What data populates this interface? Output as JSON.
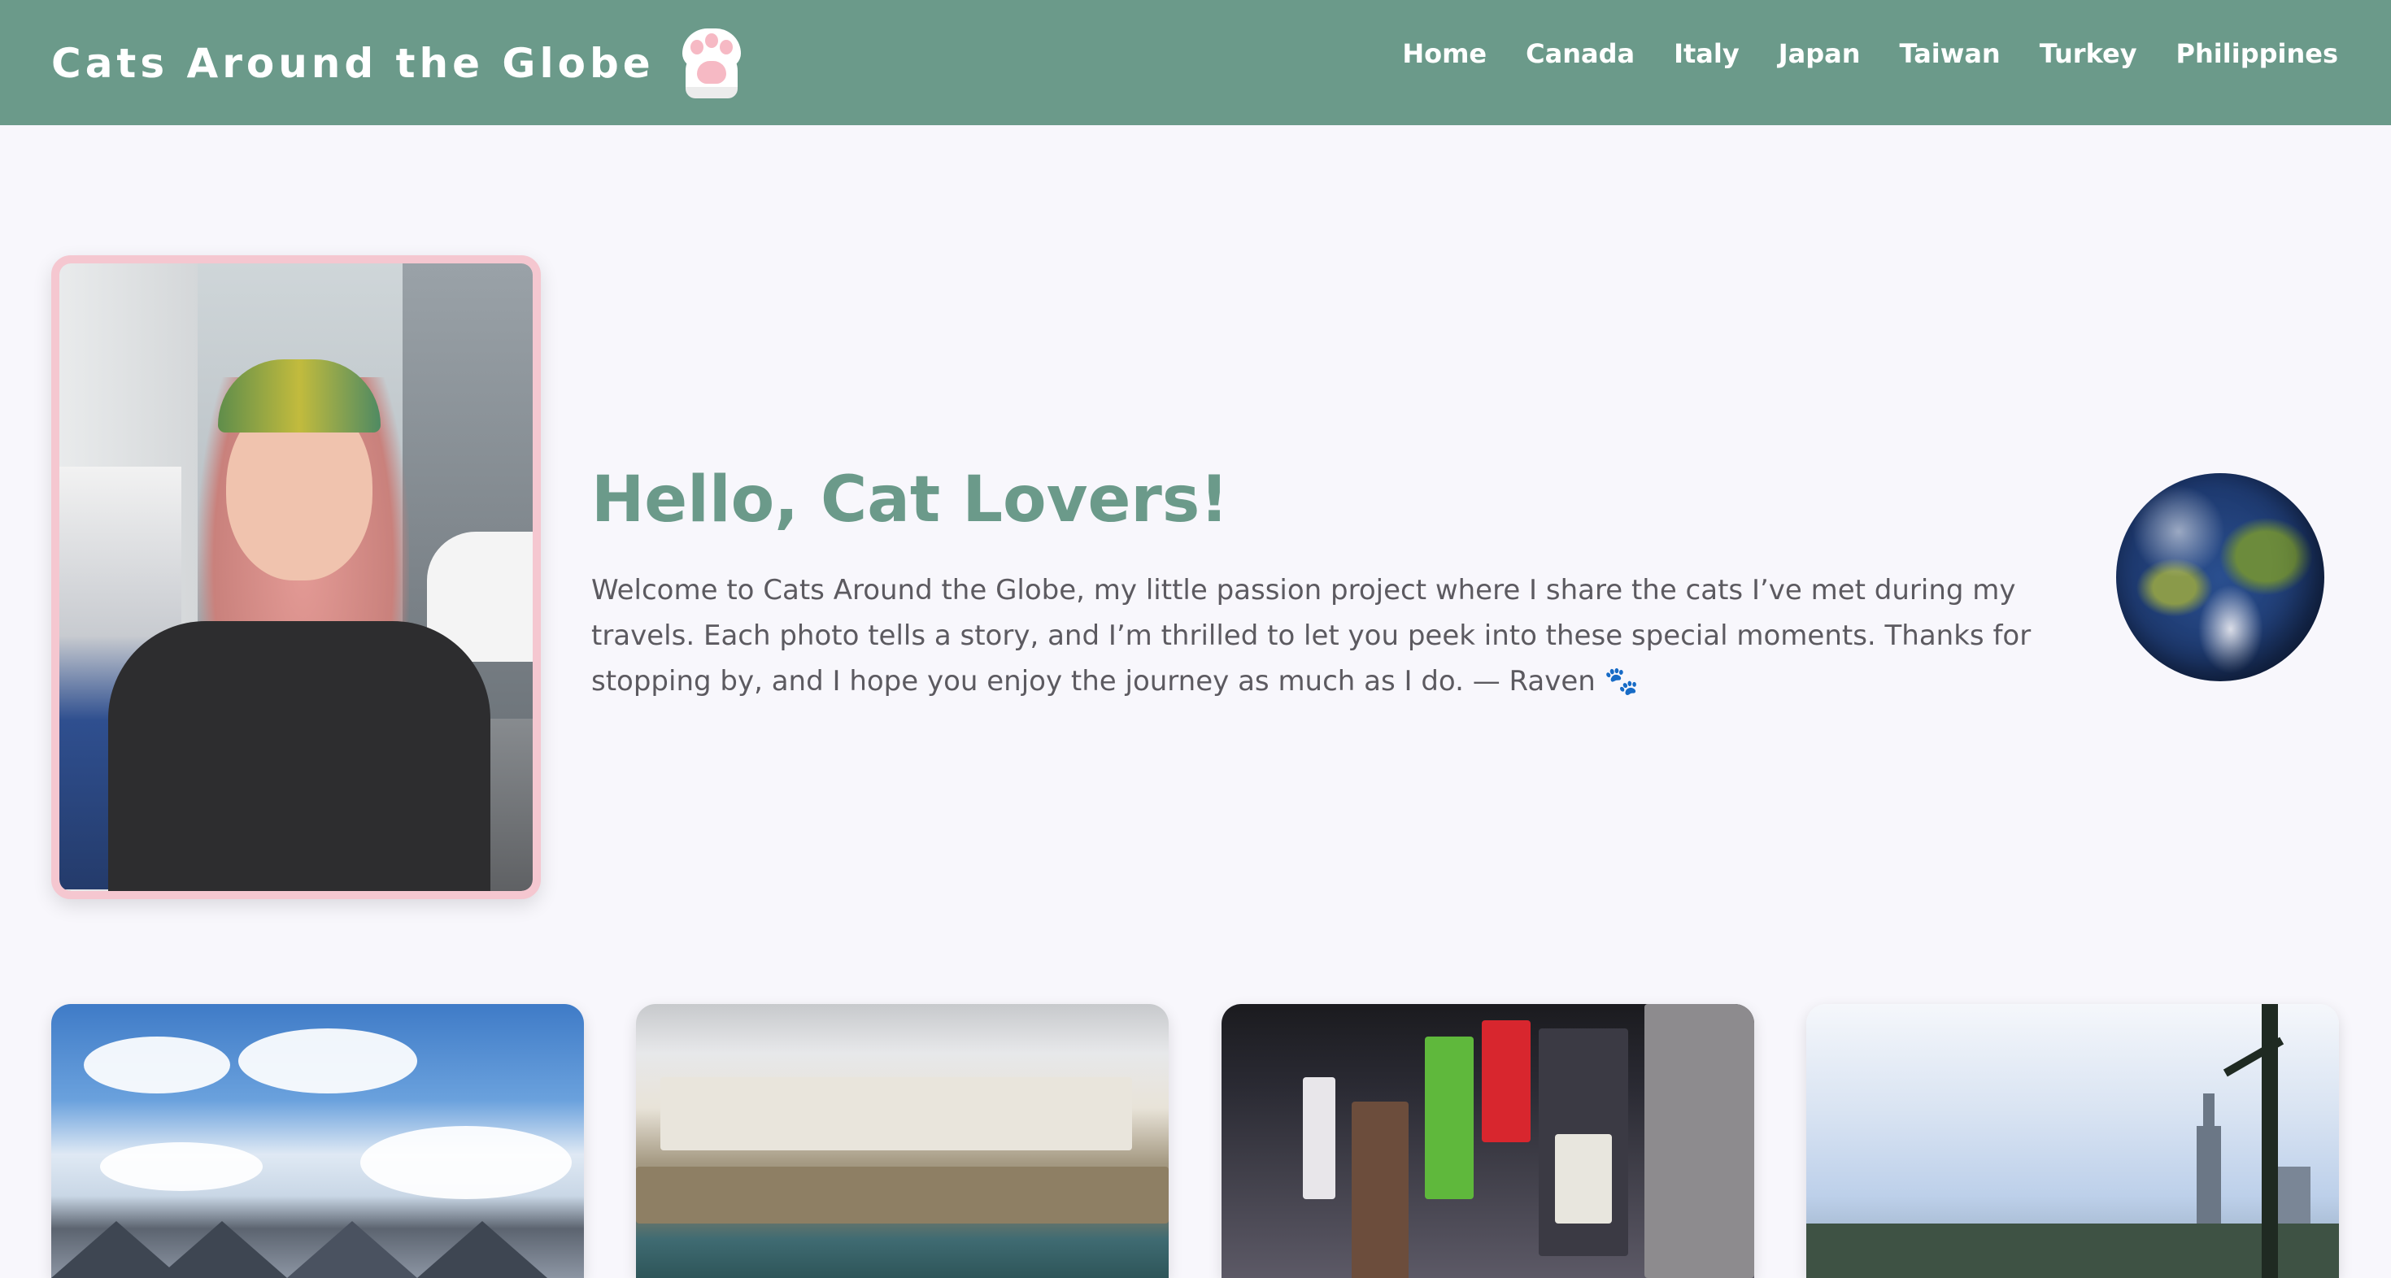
{
  "header": {
    "site_title": "Cats Around the Globe",
    "logo_icon": "paw-sock-icon",
    "nav": [
      {
        "label": "Home"
      },
      {
        "label": "Canada"
      },
      {
        "label": "Italy"
      },
      {
        "label": "Japan"
      },
      {
        "label": "Taiwan"
      },
      {
        "label": "Turkey"
      },
      {
        "label": "Philippines"
      }
    ]
  },
  "hero": {
    "title": "Hello, Cat Lovers!",
    "text": "Welcome to Cats Around the Globe, my little passion project where I share the cats I’ve met during my travels. Each photo tells a story, and I’m thrilled to let you peek into these special moments. Thanks for stopping by, and I hope you enjoy the journey as much as I do. — Raven 🐾",
    "globe_icon": "earth-globe-icon"
  },
  "cards": [
    {
      "image": "canada-mountains-photo"
    },
    {
      "image": "italy-coast-photo"
    },
    {
      "image": "japan-city-night-photo"
    },
    {
      "image": "taiwan-skyline-photo"
    }
  ],
  "colors": {
    "header_bg": "#6b9a8a",
    "accent_green": "#6b9a8a",
    "portrait_border": "#f5c7d0",
    "page_bg": "#f8f7fc",
    "body_text": "#5c5a60"
  }
}
